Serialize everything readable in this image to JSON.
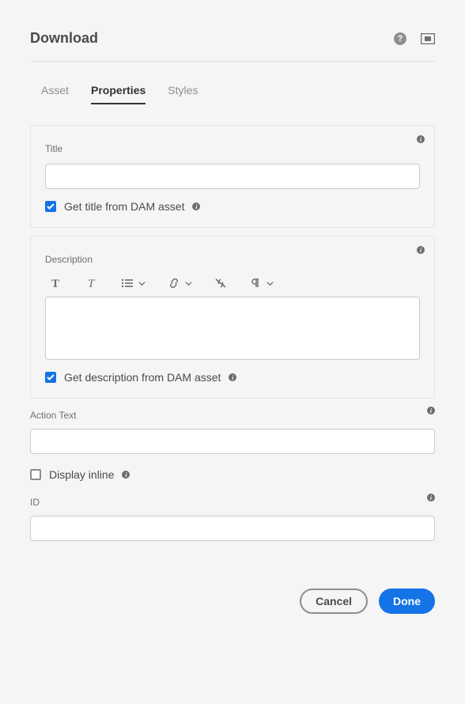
{
  "header": {
    "title": "Download"
  },
  "tabs": {
    "asset": "Asset",
    "properties": "Properties",
    "styles": "Styles",
    "active": "properties"
  },
  "sections": {
    "title_panel": {
      "label": "Title",
      "value": "",
      "checkbox_label": "Get title from DAM asset",
      "checkbox_checked": true
    },
    "description_panel": {
      "label": "Description",
      "value": "",
      "checkbox_label": "Get description from DAM asset",
      "checkbox_checked": true
    },
    "action_text": {
      "label": "Action Text",
      "value": ""
    },
    "display_inline": {
      "label": "Display inline",
      "checked": false
    },
    "id_field": {
      "label": "ID",
      "value": ""
    }
  },
  "footer": {
    "cancel": "Cancel",
    "done": "Done"
  }
}
